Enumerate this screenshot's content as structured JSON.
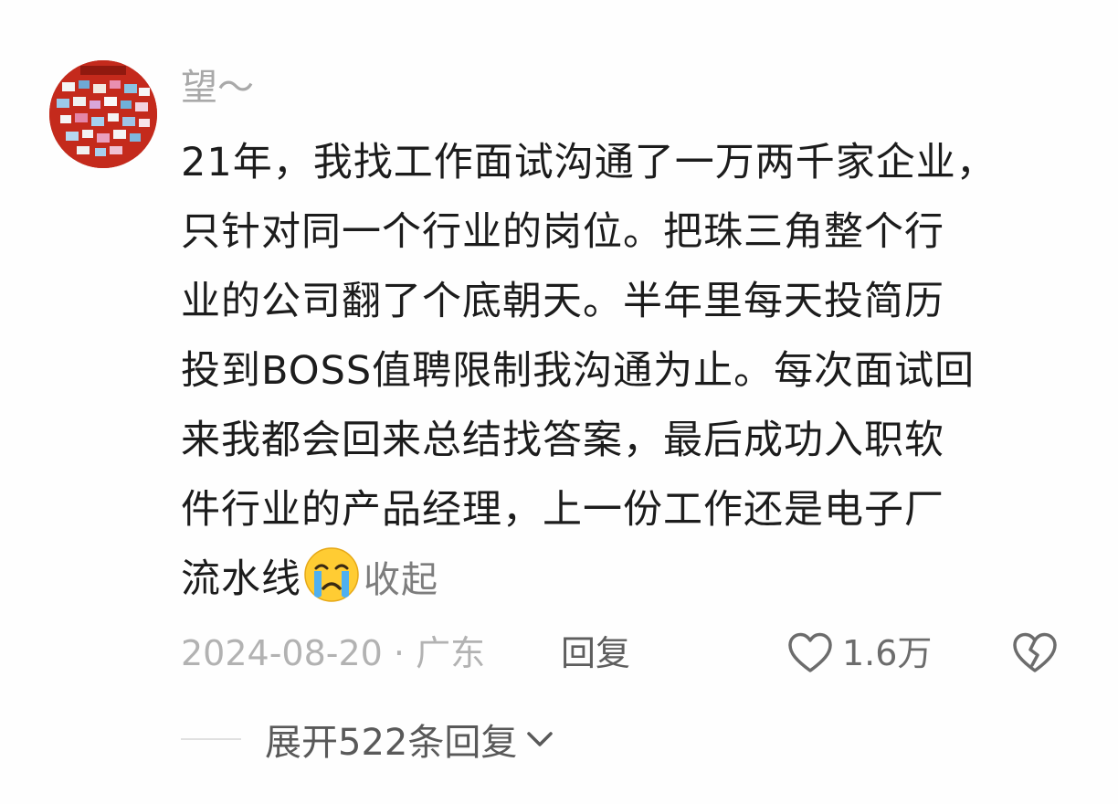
{
  "comment": {
    "username": "望～",
    "text_lines": [
      "21年，我找工作面试沟通了一万两千家企业，",
      "只针对同一个行业的岗位。把珠三角整个行",
      "业的公司翻了个底朝天。半年里每天投简历",
      "投到BOSS值聘限制我沟通为止。每次面试回",
      "来我都会回来总结找答案，最后成功入职软",
      "件行业的产品经理，上一份工作还是电子厂"
    ],
    "last_line_text": "流水线",
    "emoji": "crying-face-emoji",
    "collapse_label": "收起",
    "date_location": "2024-08-20 · 广东",
    "reply_label": "回复",
    "like_count": "1.6万",
    "expand_label": "展开522条回复"
  },
  "colors": {
    "username": "#a9a9a9",
    "body_text": "#1c1c1c",
    "meta_text": "#b2b2b2",
    "reply_text": "#5e5e5e",
    "avatar_red": "#c8261a"
  }
}
